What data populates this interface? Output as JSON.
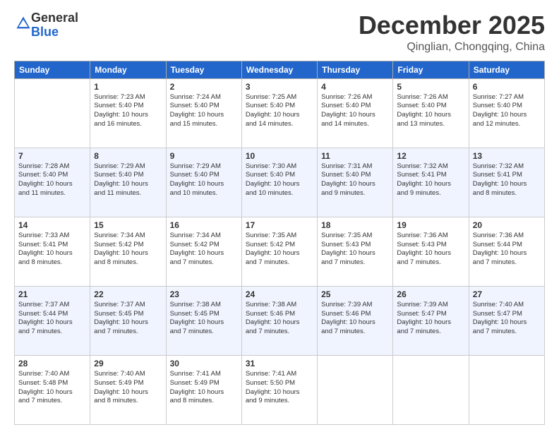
{
  "header": {
    "logo_general": "General",
    "logo_blue": "Blue",
    "month": "December 2025",
    "location": "Qinglian, Chongqing, China"
  },
  "weekdays": [
    "Sunday",
    "Monday",
    "Tuesday",
    "Wednesday",
    "Thursday",
    "Friday",
    "Saturday"
  ],
  "weeks": [
    [
      {
        "day": "",
        "info": ""
      },
      {
        "day": "1",
        "info": "Sunrise: 7:23 AM\nSunset: 5:40 PM\nDaylight: 10 hours\nand 16 minutes."
      },
      {
        "day": "2",
        "info": "Sunrise: 7:24 AM\nSunset: 5:40 PM\nDaylight: 10 hours\nand 15 minutes."
      },
      {
        "day": "3",
        "info": "Sunrise: 7:25 AM\nSunset: 5:40 PM\nDaylight: 10 hours\nand 14 minutes."
      },
      {
        "day": "4",
        "info": "Sunrise: 7:26 AM\nSunset: 5:40 PM\nDaylight: 10 hours\nand 14 minutes."
      },
      {
        "day": "5",
        "info": "Sunrise: 7:26 AM\nSunset: 5:40 PM\nDaylight: 10 hours\nand 13 minutes."
      },
      {
        "day": "6",
        "info": "Sunrise: 7:27 AM\nSunset: 5:40 PM\nDaylight: 10 hours\nand 12 minutes."
      }
    ],
    [
      {
        "day": "7",
        "info": "Sunrise: 7:28 AM\nSunset: 5:40 PM\nDaylight: 10 hours\nand 11 minutes."
      },
      {
        "day": "8",
        "info": "Sunrise: 7:29 AM\nSunset: 5:40 PM\nDaylight: 10 hours\nand 11 minutes."
      },
      {
        "day": "9",
        "info": "Sunrise: 7:29 AM\nSunset: 5:40 PM\nDaylight: 10 hours\nand 10 minutes."
      },
      {
        "day": "10",
        "info": "Sunrise: 7:30 AM\nSunset: 5:40 PM\nDaylight: 10 hours\nand 10 minutes."
      },
      {
        "day": "11",
        "info": "Sunrise: 7:31 AM\nSunset: 5:40 PM\nDaylight: 10 hours\nand 9 minutes."
      },
      {
        "day": "12",
        "info": "Sunrise: 7:32 AM\nSunset: 5:41 PM\nDaylight: 10 hours\nand 9 minutes."
      },
      {
        "day": "13",
        "info": "Sunrise: 7:32 AM\nSunset: 5:41 PM\nDaylight: 10 hours\nand 8 minutes."
      }
    ],
    [
      {
        "day": "14",
        "info": "Sunrise: 7:33 AM\nSunset: 5:41 PM\nDaylight: 10 hours\nand 8 minutes."
      },
      {
        "day": "15",
        "info": "Sunrise: 7:34 AM\nSunset: 5:42 PM\nDaylight: 10 hours\nand 8 minutes."
      },
      {
        "day": "16",
        "info": "Sunrise: 7:34 AM\nSunset: 5:42 PM\nDaylight: 10 hours\nand 7 minutes."
      },
      {
        "day": "17",
        "info": "Sunrise: 7:35 AM\nSunset: 5:42 PM\nDaylight: 10 hours\nand 7 minutes."
      },
      {
        "day": "18",
        "info": "Sunrise: 7:35 AM\nSunset: 5:43 PM\nDaylight: 10 hours\nand 7 minutes."
      },
      {
        "day": "19",
        "info": "Sunrise: 7:36 AM\nSunset: 5:43 PM\nDaylight: 10 hours\nand 7 minutes."
      },
      {
        "day": "20",
        "info": "Sunrise: 7:36 AM\nSunset: 5:44 PM\nDaylight: 10 hours\nand 7 minutes."
      }
    ],
    [
      {
        "day": "21",
        "info": "Sunrise: 7:37 AM\nSunset: 5:44 PM\nDaylight: 10 hours\nand 7 minutes."
      },
      {
        "day": "22",
        "info": "Sunrise: 7:37 AM\nSunset: 5:45 PM\nDaylight: 10 hours\nand 7 minutes."
      },
      {
        "day": "23",
        "info": "Sunrise: 7:38 AM\nSunset: 5:45 PM\nDaylight: 10 hours\nand 7 minutes."
      },
      {
        "day": "24",
        "info": "Sunrise: 7:38 AM\nSunset: 5:46 PM\nDaylight: 10 hours\nand 7 minutes."
      },
      {
        "day": "25",
        "info": "Sunrise: 7:39 AM\nSunset: 5:46 PM\nDaylight: 10 hours\nand 7 minutes."
      },
      {
        "day": "26",
        "info": "Sunrise: 7:39 AM\nSunset: 5:47 PM\nDaylight: 10 hours\nand 7 minutes."
      },
      {
        "day": "27",
        "info": "Sunrise: 7:40 AM\nSunset: 5:47 PM\nDaylight: 10 hours\nand 7 minutes."
      }
    ],
    [
      {
        "day": "28",
        "info": "Sunrise: 7:40 AM\nSunset: 5:48 PM\nDaylight: 10 hours\nand 7 minutes."
      },
      {
        "day": "29",
        "info": "Sunrise: 7:40 AM\nSunset: 5:49 PM\nDaylight: 10 hours\nand 8 minutes."
      },
      {
        "day": "30",
        "info": "Sunrise: 7:41 AM\nSunset: 5:49 PM\nDaylight: 10 hours\nand 8 minutes."
      },
      {
        "day": "31",
        "info": "Sunrise: 7:41 AM\nSunset: 5:50 PM\nDaylight: 10 hours\nand 9 minutes."
      },
      {
        "day": "",
        "info": ""
      },
      {
        "day": "",
        "info": ""
      },
      {
        "day": "",
        "info": ""
      }
    ]
  ]
}
